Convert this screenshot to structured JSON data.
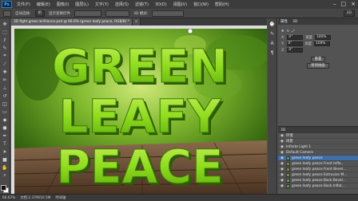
{
  "app": {
    "logo": "Ps",
    "menu": [
      "文件(F)",
      "编辑(E)",
      "图像(I)",
      "图层(L)",
      "文字(Y)",
      "选择(S)",
      "滤镜(T)",
      "3D(D)",
      "视图(V)",
      "窗口(W)",
      "帮助(H)"
    ],
    "window_controls": [
      "–",
      "□",
      "×"
    ]
  },
  "options_bar": {
    "auto_select_label": "自动选择:",
    "auto_select_value": "组",
    "transform_label": "显示变换控件",
    "mode_label": "3D 模式:",
    "workspace_value": "3D"
  },
  "document": {
    "tab_active": "3D fight green brilliance.psd @ 66.6% (green leafy peace, RGB/8) *",
    "tab_other": "×"
  },
  "artwork": {
    "line1": "GREEN",
    "line2": "LEAFY",
    "line3": "PEACE",
    "text_color": "#8fdc1c",
    "shadow_color": "#2e5a05"
  },
  "properties": {
    "title": "属性",
    "tab2": "3D",
    "fields": [
      {
        "label": "X:",
        "value": "0°"
      },
      {
        "label": "Y:",
        "value": "0°"
      },
      {
        "label": "Z:",
        "value": "0°"
      }
    ],
    "size_labels": [
      "宽度",
      "高度"
    ],
    "size_values": [
      "100%",
      "100%"
    ],
    "button_reset": "重置",
    "button_move": "移到地面"
  },
  "layers": {
    "title": "3D",
    "rows": [
      {
        "name": "环境",
        "selected": false
      },
      {
        "name": "场景",
        "selected": false
      },
      {
        "name": "Infinite Light 1",
        "selected": false
      },
      {
        "name": "Default Camera",
        "selected": false
      },
      {
        "name": "green leafy peace",
        "selected": true
      },
      {
        "name": "green leafy peace Front Infla...",
        "selected": false
      },
      {
        "name": "green leafy peace Front Bevel...",
        "selected": false
      },
      {
        "name": "green leafy peace Extrusion M...",
        "selected": false
      },
      {
        "name": "green leafy peace Back Bevel...",
        "selected": false
      },
      {
        "name": "green leafy peace Back Inflat...",
        "selected": false
      }
    ]
  },
  "status_bar": {
    "zoom": "66.67%",
    "doc_info": "文档:2.37M/10.5M",
    "timeline": "时间轴"
  }
}
